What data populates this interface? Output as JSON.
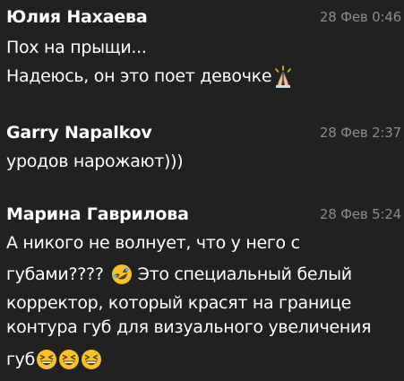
{
  "comments": [
    {
      "author": "Юлия Нахаева",
      "date": "28 Фев 0:46",
      "lines": [
        "Пох на прыщи...",
        "Надеюсь, он это поет девочке"
      ]
    },
    {
      "author": "Garry Napalkov",
      "date": "28 Фев 2:37",
      "lines": [
        "уродов нарожают)))"
      ]
    },
    {
      "author": "Марина Гаврилова",
      "date": "28 Фев 5:24",
      "lines": [
        "А никого не волнует, что у него с",
        "губами????",
        "Это специальный белый",
        "корректор, который красят на границе",
        "контура губ для визуального  увеличения",
        "губ"
      ]
    }
  ],
  "icons": {
    "pray": "folded-hands-emoji",
    "rofl": "rolling-on-floor-laughing-emoji",
    "laugh": "grinning-squinting-face-emoji"
  },
  "colors": {
    "background": "#212121",
    "text": "#ffffff",
    "date": "#8c8c8c",
    "emoji_yellow": "#f7c229"
  }
}
